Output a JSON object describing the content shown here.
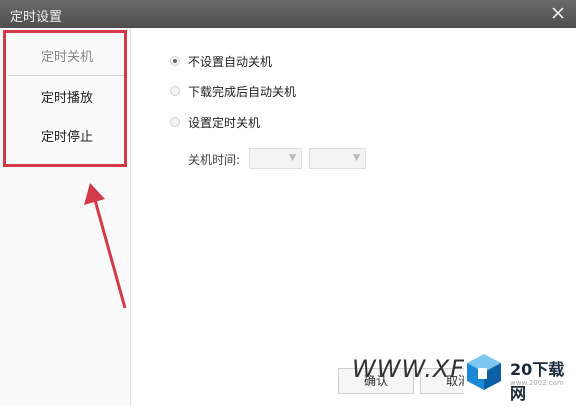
{
  "window": {
    "title": "定时设置"
  },
  "sidebar": {
    "items": [
      {
        "label": "定时关机",
        "active": true
      },
      {
        "label": "定时播放",
        "active": false
      },
      {
        "label": "定时停止",
        "active": false
      }
    ]
  },
  "options": [
    {
      "label": "不设置自动关机",
      "checked": true
    },
    {
      "label": "下载完成后自动关机",
      "checked": false
    },
    {
      "label": "设置定时关机",
      "checked": false
    }
  ],
  "shutdown_time": {
    "label": "关机时间:",
    "hour_value": "",
    "minute_value": ""
  },
  "buttons": {
    "confirm": "确认",
    "cancel": "取消"
  },
  "watermark": {
    "text": "WWW.XFD",
    "brand": "20下载网",
    "url": "www.2002.com"
  },
  "colors": {
    "highlight": "#d23a48",
    "titlebar": "#5a5a5a",
    "accent": "#1a8ad4"
  }
}
